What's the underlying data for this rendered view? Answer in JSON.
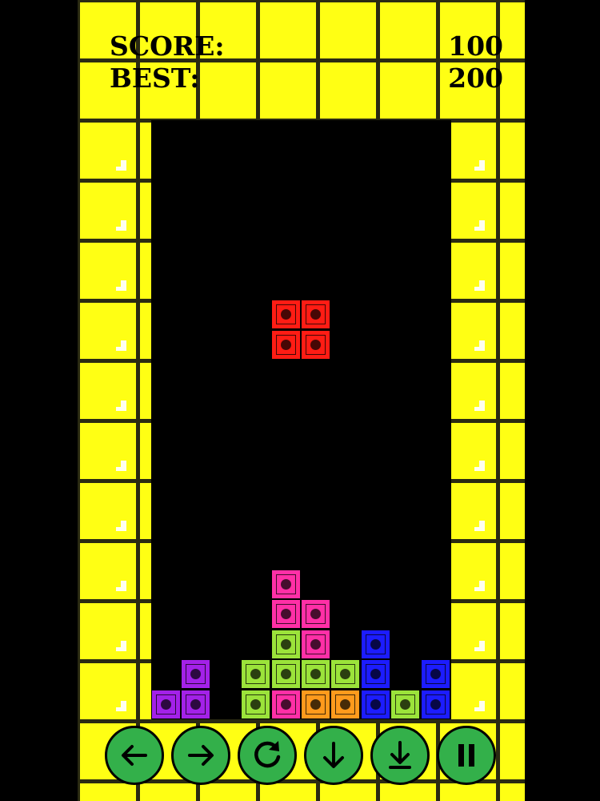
{
  "game": {
    "title": ""
  },
  "scoreboard": {
    "score_label": "SCORE:",
    "score_value": "100",
    "best_label": "BEST:",
    "best_value": "200"
  },
  "board": {
    "columns": 10,
    "rows": 20,
    "falling_piece": {
      "type": "O",
      "color": "red",
      "cells": [
        [
          4,
          6
        ],
        [
          5,
          6
        ],
        [
          4,
          7
        ],
        [
          5,
          7
        ]
      ]
    },
    "settled_blocks": [
      {
        "col": 4,
        "row": 15,
        "color": "pink"
      },
      {
        "col": 4,
        "row": 16,
        "color": "pink"
      },
      {
        "col": 5,
        "row": 16,
        "color": "pink"
      },
      {
        "col": 4,
        "row": 17,
        "color": "lime"
      },
      {
        "col": 5,
        "row": 17,
        "color": "pink"
      },
      {
        "col": 7,
        "row": 17,
        "color": "blue"
      },
      {
        "col": 1,
        "row": 18,
        "color": "purple"
      },
      {
        "col": 3,
        "row": 18,
        "color": "lime"
      },
      {
        "col": 4,
        "row": 18,
        "color": "lime"
      },
      {
        "col": 5,
        "row": 18,
        "color": "lime"
      },
      {
        "col": 6,
        "row": 18,
        "color": "lime"
      },
      {
        "col": 7,
        "row": 18,
        "color": "blue"
      },
      {
        "col": 9,
        "row": 18,
        "color": "blue"
      },
      {
        "col": 0,
        "row": 19,
        "color": "purple"
      },
      {
        "col": 1,
        "row": 19,
        "color": "purple"
      },
      {
        "col": 3,
        "row": 19,
        "color": "lime"
      },
      {
        "col": 4,
        "row": 19,
        "color": "pink"
      },
      {
        "col": 5,
        "row": 19,
        "color": "orange"
      },
      {
        "col": 6,
        "row": 19,
        "color": "orange"
      },
      {
        "col": 7,
        "row": 19,
        "color": "blue"
      },
      {
        "col": 8,
        "row": 19,
        "color": "lime"
      },
      {
        "col": 9,
        "row": 19,
        "color": "blue"
      }
    ]
  },
  "colors": {
    "frame": "#ffff14",
    "grid_line": "#2a2a12",
    "background": "#000000",
    "control_button": "#33b04a",
    "red": "#ff1c14",
    "pink": "#ff2fa6",
    "lime": "#9be33a",
    "purple": "#a321e8",
    "blue": "#1c1cff",
    "orange": "#ff9a1c"
  },
  "controls": [
    {
      "name": "move-left-button",
      "icon": "arrow-left-icon"
    },
    {
      "name": "move-right-button",
      "icon": "arrow-right-icon"
    },
    {
      "name": "rotate-button",
      "icon": "rotate-icon"
    },
    {
      "name": "soft-drop-button",
      "icon": "arrow-down-icon"
    },
    {
      "name": "hard-drop-button",
      "icon": "arrow-down-bar-icon"
    },
    {
      "name": "pause-button",
      "icon": "pause-icon"
    }
  ]
}
